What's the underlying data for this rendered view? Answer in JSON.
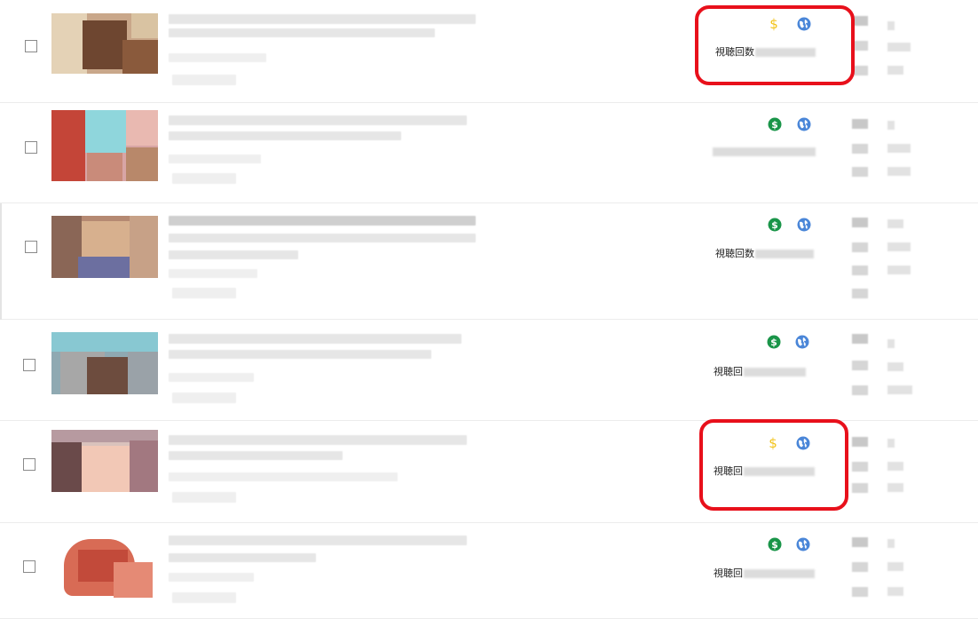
{
  "views_label": "視聴回数",
  "colors": {
    "monetization_on": "#1a9549",
    "monetization_limited": "#f2c31a",
    "visibility_public": "#4a86d8",
    "highlight": "#e8101b"
  },
  "videos": [
    {
      "views_text": "視聴回数",
      "monetization": "limited",
      "monetization_icon": "yellow-dollar-icon",
      "visibility_icon": "globe-icon",
      "highlighted": true
    },
    {
      "views_text": "",
      "monetization": "on",
      "monetization_icon": "green-dollar-icon",
      "visibility_icon": "globe-icon",
      "highlighted": false
    },
    {
      "views_text": "視聴回数",
      "monetization": "on",
      "monetization_icon": "green-dollar-icon",
      "visibility_icon": "globe-icon",
      "highlighted": false
    },
    {
      "views_text": "視聴回",
      "monetization": "on",
      "monetization_icon": "green-dollar-icon",
      "visibility_icon": "globe-icon",
      "highlighted": false
    },
    {
      "views_text": "視聴回",
      "monetization": "limited",
      "monetization_icon": "yellow-dollar-icon",
      "visibility_icon": "globe-icon",
      "highlighted": true
    },
    {
      "views_text": "視聴回",
      "monetization": "on",
      "monetization_icon": "green-dollar-icon",
      "visibility_icon": "globe-icon",
      "highlighted": false
    }
  ]
}
